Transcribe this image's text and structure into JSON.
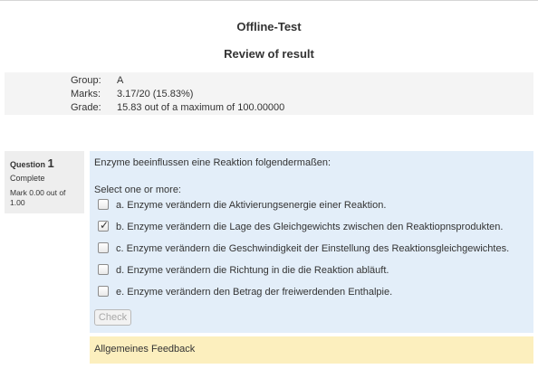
{
  "header": {
    "title": "Offline-Test",
    "subtitle": "Review of result"
  },
  "summary": {
    "rows": [
      {
        "label": "Group:",
        "value": "A"
      },
      {
        "label": "Marks:",
        "value": "3.17/20 (15.83%)"
      },
      {
        "label": "Grade:",
        "value": "15.83 out of a maximum of 100.00000"
      }
    ]
  },
  "question": {
    "label": "Question",
    "number": "1",
    "state": "Complete",
    "mark": "Mark 0.00 out of 1.00",
    "text": "Enzyme beeinflussen eine Reaktion folgendermaßen:",
    "prompt": "Select one or more:",
    "options": [
      {
        "text": "a. Enzyme verändern die Aktivierungsenergie einer Reaktion.",
        "checked": false
      },
      {
        "text": "b. Enzyme verändern die Lage des Gleichgewichts zwischen den Reaktiopnsprodukten.",
        "checked": true
      },
      {
        "text": "c. Enzyme verändern die Geschwindigkeit der Einstellung des Reaktionsgleichgewichtes.",
        "checked": false
      },
      {
        "text": "d. Enzyme verändern die Richtung in die die Reaktion abläuft.",
        "checked": false
      },
      {
        "text": "e. Enzyme verändern den Betrag der freiwerdenden Enthalpie.",
        "checked": false
      }
    ],
    "check_label": "Check",
    "feedback": "Allgemeines Feedback"
  },
  "colors": {
    "content_bg": "#e3eef9",
    "info_bg": "#eeeeee",
    "summary_bg": "#f4f4f4",
    "feedback_bg": "#fcefbe"
  }
}
